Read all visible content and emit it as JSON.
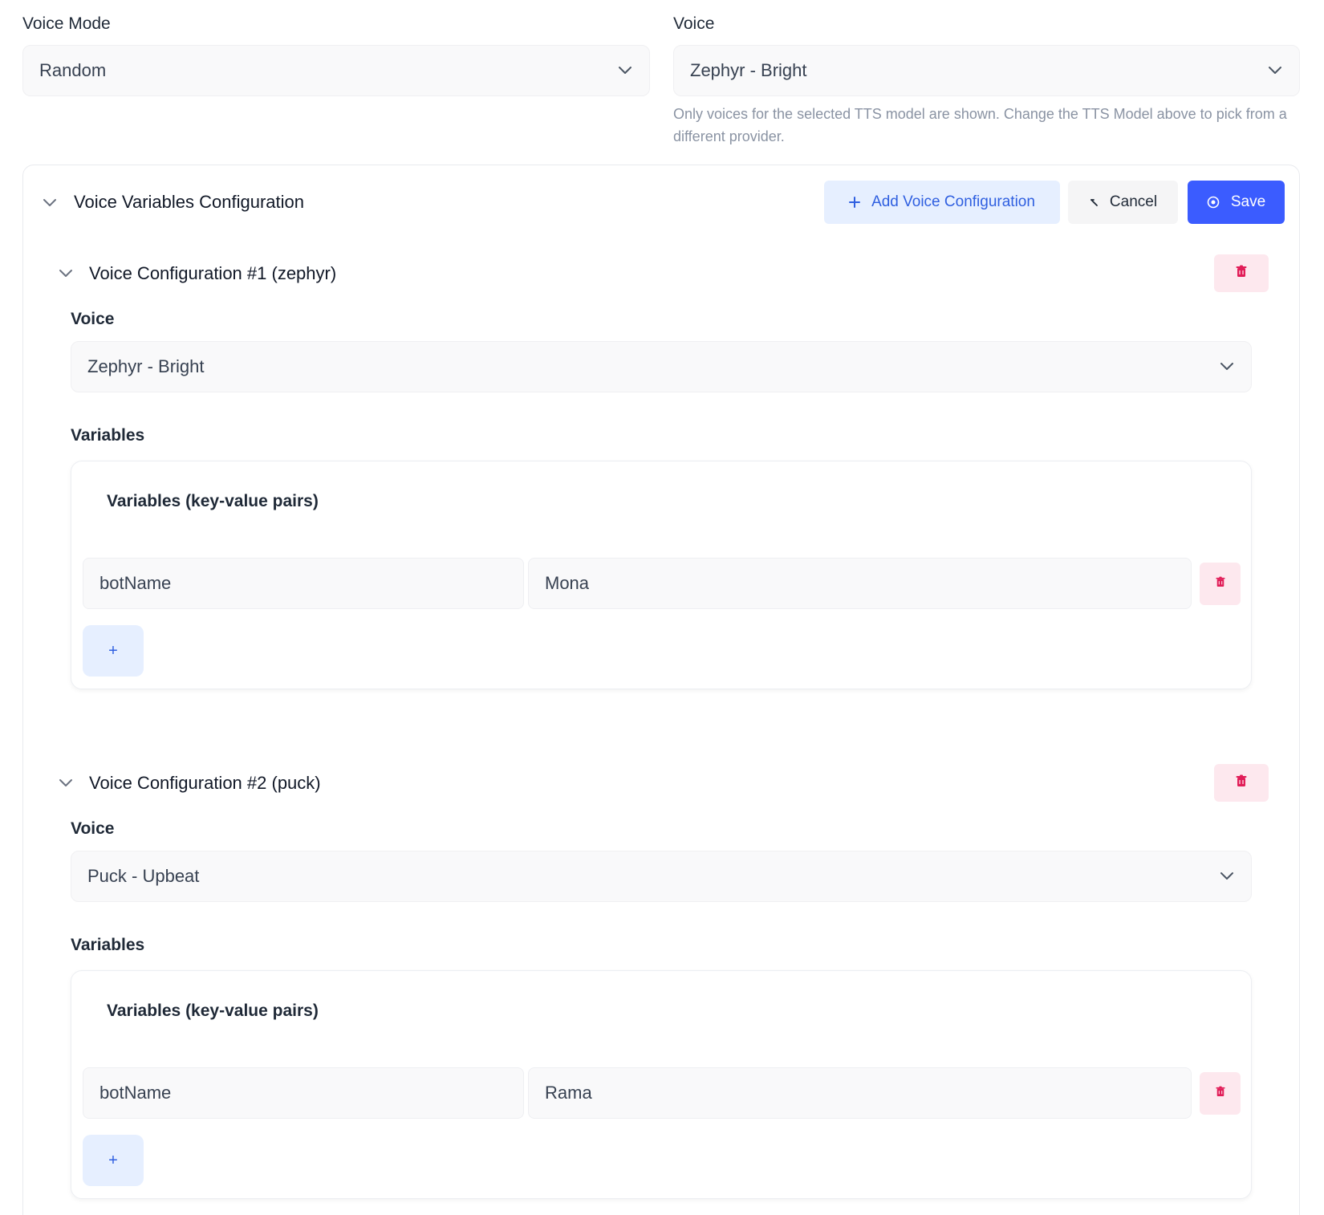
{
  "voice_mode": {
    "label": "Voice Mode",
    "value": "Random"
  },
  "voice": {
    "label": "Voice",
    "value": "Zephyr - Bright",
    "helper": "Only voices for the selected TTS model are shown. Change the TTS Model above to pick from a different provider."
  },
  "panel": {
    "title": "Voice Variables Configuration",
    "add_label": "Add Voice Configuration",
    "cancel_label": "Cancel",
    "save_label": "Save",
    "add_icon": "plus-icon",
    "cancel_icon": "close-icon",
    "save_icon": "save-icon"
  },
  "configs": [
    {
      "title": "Voice Configuration #1 (zephyr)",
      "voice_label": "Voice",
      "voice_value": "Zephyr - Bright",
      "variables_label": "Variables",
      "card_title": "Variables (key-value pairs)",
      "rows": [
        {
          "key": "botName",
          "value": "Mona"
        }
      ],
      "add_symbol": "+"
    },
    {
      "title": "Voice Configuration #2 (puck)",
      "voice_label": "Voice",
      "voice_value": "Puck - Upbeat",
      "variables_label": "Variables",
      "card_title": "Variables (key-value pairs)",
      "rows": [
        {
          "key": "botName",
          "value": "Rama"
        }
      ],
      "add_symbol": "+"
    }
  ],
  "colors": {
    "primary": "#3b5cff",
    "primary_soft": "#e6efff",
    "danger": "#e11d58",
    "danger_soft": "#fde8ee"
  }
}
